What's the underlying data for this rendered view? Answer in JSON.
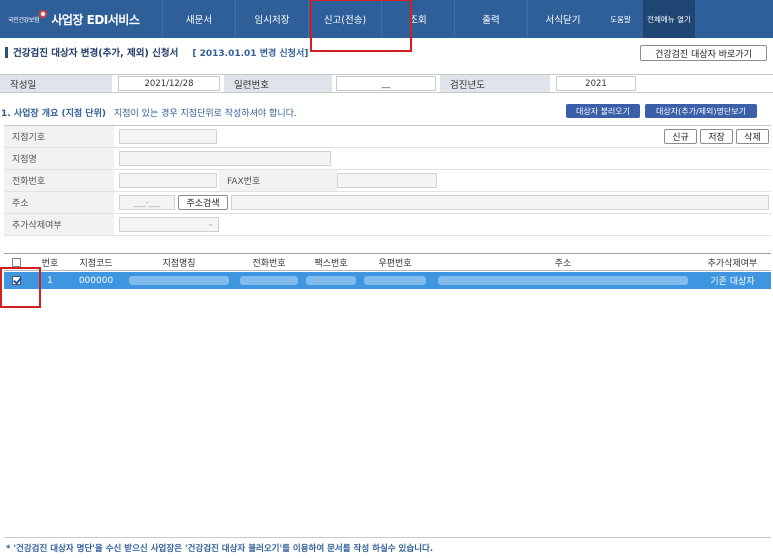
{
  "nav": {
    "logo_text": "국민건강보험",
    "service": "사업장 EDI서비스",
    "items": [
      "새문서",
      "임시저장",
      "신고(전송)",
      "조회",
      "출력",
      "서식닫기"
    ],
    "help": "도움말",
    "all_menu": "전체메뉴 열기"
  },
  "header": {
    "title": "건강검진 대상자 변경(추가, 제외) 신청서",
    "subtitle": "[ 2013.01.01 변경 신청서]",
    "shortcut_button": "건강검진 대상자 바로가기"
  },
  "info": {
    "written_label": "작성일",
    "written_value": "2021/12/28",
    "serial_label": "일련번호",
    "serial_value": "__",
    "year_label": "검진년도",
    "year_value": "2021"
  },
  "section1": {
    "title": "1. 사업장 개요 (지점 단위)",
    "note": "지점이 있는 경우 지점단위로 작성하셔야 합니다.",
    "load_button": "대상자 불러오기",
    "view_button": "대상자(추가/제외)명단보기"
  },
  "form": {
    "branch_code_label": "지점기호",
    "branch_name_label": "지점명",
    "phone_label": "전화번호",
    "fax_label": "FAX번호",
    "address_label": "주소",
    "postal_placeholder": "___-___",
    "address_search": "주소검색",
    "addremove_label": "추가삭제여부",
    "new_button": "신규",
    "save_button": "저장",
    "delete_button": "삭제"
  },
  "table": {
    "headers": [
      "번호",
      "지점코드",
      "지점명칭",
      "전화번호",
      "팩스번호",
      "우편번호",
      "주소",
      "추가삭제여부"
    ],
    "rows": [
      {
        "checked": true,
        "no": "1",
        "code": "000000",
        "status": "기존 대상자"
      }
    ]
  },
  "footnote": "* '건강검진 대상자 명단'을 수신 받으신 사업장은 '건강검진 대상자 불러오기'를 이용하여 문서를 작성 하실수 있습니다.",
  "colors": {
    "nav_bg": "#2f5f99",
    "accent": "#3b5fa8",
    "selected_row": "#3e95e0",
    "highlight": "#d21f1f"
  }
}
